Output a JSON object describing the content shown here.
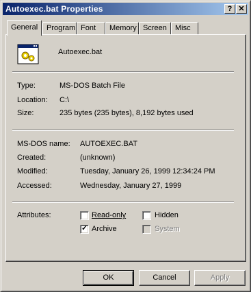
{
  "window": {
    "title": "Autoexec.bat Properties",
    "help_glyph": "?",
    "close_glyph": "✕"
  },
  "tabs": [
    {
      "label": "General",
      "active": true
    },
    {
      "label": "Program"
    },
    {
      "label": "Font"
    },
    {
      "label": "Memory"
    },
    {
      "label": "Screen"
    },
    {
      "label": "Misc"
    }
  ],
  "file": {
    "name": "Autoexec.bat",
    "icon": "batch-file-icon"
  },
  "info": {
    "type_label": "Type:",
    "type_value": "MS-DOS Batch File",
    "location_label": "Location:",
    "location_value": "C:\\",
    "size_label": "Size:",
    "size_value": "235 bytes (235 bytes), 8,192 bytes used"
  },
  "dates": {
    "dosname_label": "MS-DOS name:",
    "dosname_value": "AUTOEXEC.BAT",
    "created_label": "Created:",
    "created_value": "(unknown)",
    "modified_label": "Modified:",
    "modified_value": "Tuesday, January 26, 1999 12:34:24 PM",
    "accessed_label": "Accessed:",
    "accessed_value": "Wednesday, January 27, 1999"
  },
  "attributes": {
    "label": "Attributes:",
    "readonly": {
      "label": "Read-only",
      "checked": false,
      "enabled": true
    },
    "hidden": {
      "label": "Hidden",
      "checked": false,
      "enabled": true
    },
    "archive": {
      "label": "Archive",
      "checked": true,
      "enabled": true
    },
    "system": {
      "label": "System",
      "checked": false,
      "enabled": false
    },
    "check_glyph": "✓"
  },
  "buttons": {
    "ok": "OK",
    "cancel": "Cancel",
    "apply": "Apply"
  },
  "colors": {
    "titlebar_start": "#0a246a",
    "titlebar_end": "#a6caf0",
    "face": "#d4d0c8"
  }
}
